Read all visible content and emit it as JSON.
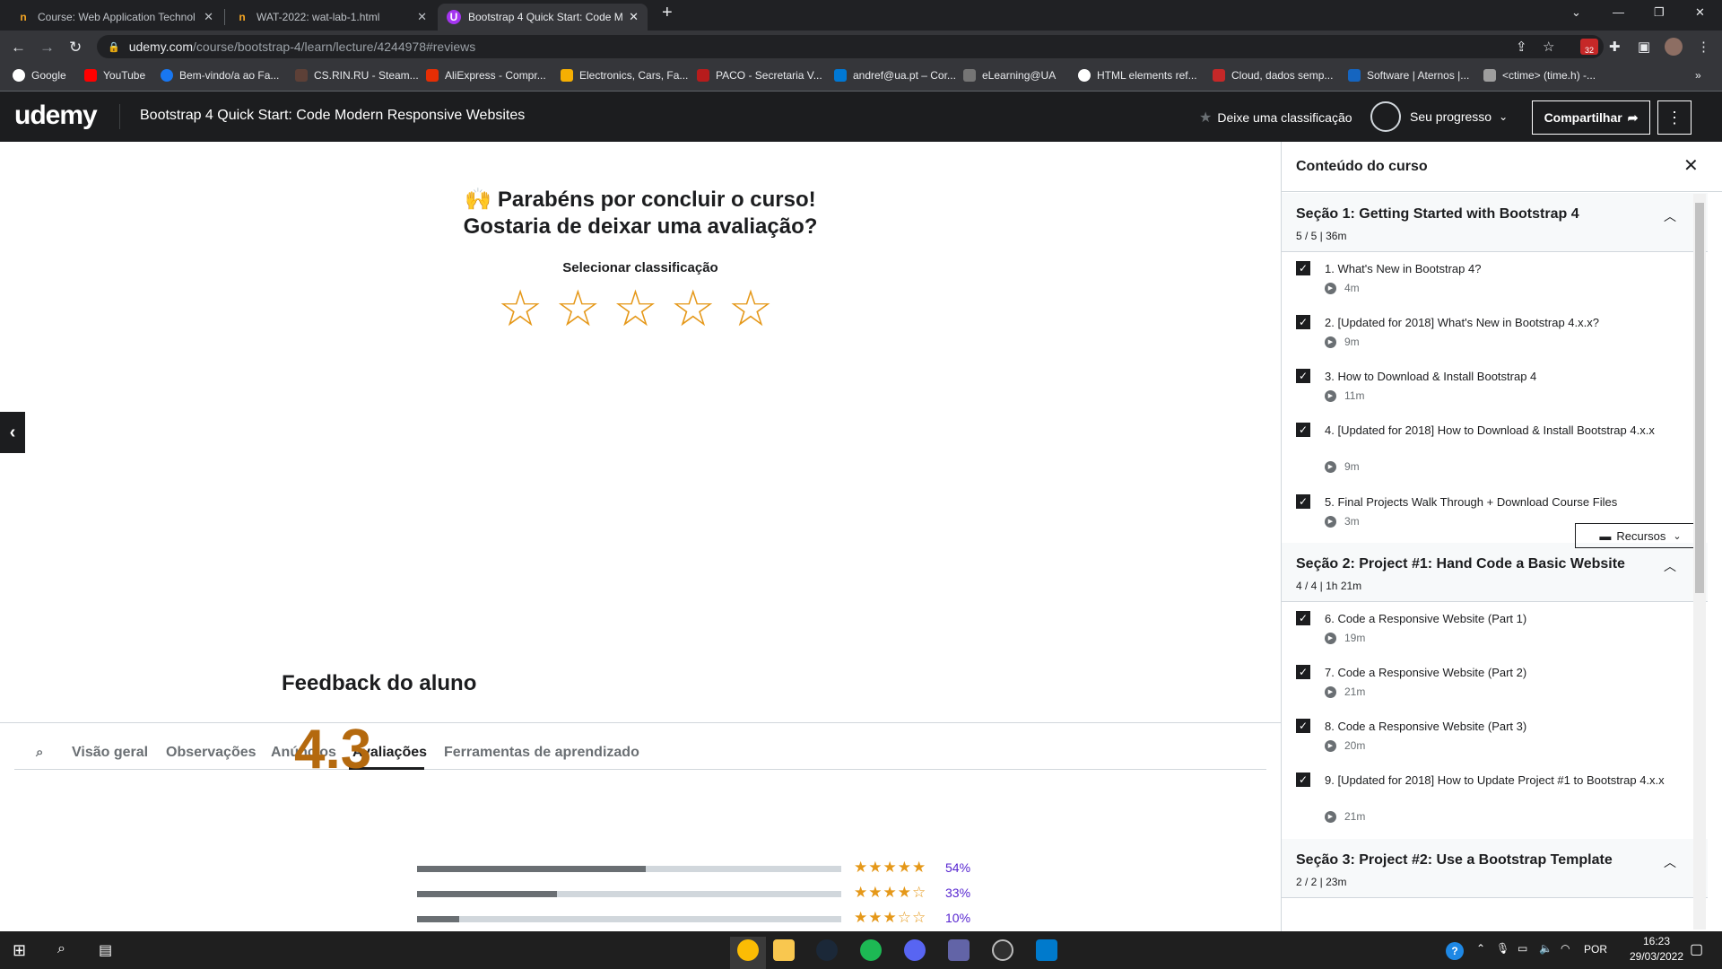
{
  "browser": {
    "tabs": [
      {
        "title": "Course: Web Application Technol",
        "icon": "n"
      },
      {
        "title": "WAT-2022: wat-lab-1.html",
        "icon": "n"
      },
      {
        "title": "Bootstrap 4 Quick Start: Code Mo",
        "icon": "U"
      }
    ],
    "url_host": "udemy.com",
    "url_path": "/course/bootstrap-4/learn/lecture/4244978#reviews",
    "bookmarks": [
      "Google",
      "YouTube",
      "Bem-vindo/a ao Fa...",
      "CS.RIN.RU - Steam...",
      "AliExpress - Compr...",
      "Electronics, Cars, Fa...",
      "PACO - Secretaria V...",
      "andref@ua.pt – Cor...",
      "eLearning@UA",
      "HTML elements ref...",
      "Cloud, dados semp...",
      "Software | Aternos |...",
      "<ctime> (time.h) -..."
    ],
    "ext_badge": "32"
  },
  "header": {
    "logo": "udemy",
    "course_title": "Bootstrap 4 Quick Start: Code Modern Responsive Websites",
    "rate_label": "Deixe uma classificação",
    "progress_label": "Seu progresso",
    "share_label": "Compartilhar"
  },
  "main": {
    "congrats_line1": "🙌 Parabéns por concluir o curso!",
    "congrats_line2": "Gostaria de deixar uma avaliação?",
    "select_rating": "Selecionar classificação",
    "stars_count": 5,
    "tabs": [
      "Visão geral",
      "Observações",
      "Anúncios",
      "Avaliações",
      "Ferramentas de aprendizado"
    ],
    "active_tab": "Avaliações",
    "feedback_title": "Feedback do aluno",
    "average_rating": "4.3",
    "rating_rows": [
      {
        "stars": 5,
        "fraction": 0.54,
        "pct": "54%"
      },
      {
        "stars": 4,
        "fraction": 0.33,
        "pct": "33%"
      },
      {
        "stars": 3,
        "fraction": 0.1,
        "pct": "10%"
      }
    ]
  },
  "sidebar": {
    "title": "Conteúdo do curso",
    "sections": [
      {
        "title": "Seção 1: Getting Started with Bootstrap 4",
        "meta": "5 / 5 | 36m",
        "lectures": [
          {
            "title": "1. What's New in Bootstrap 4?",
            "duration": "4m"
          },
          {
            "title": "2. [Updated for 2018] What's New in Bootstrap 4.x.x?",
            "duration": "9m"
          },
          {
            "title": "3. How to Download & Install Bootstrap 4",
            "duration": "11m"
          },
          {
            "title": "4. [Updated for 2018] How to Download & Install Bootstrap 4.x.x",
            "duration": "9m"
          },
          {
            "title": "5. Final Projects Walk Through + Download Course Files",
            "duration": "3m"
          }
        ]
      },
      {
        "title": "Seção 2: Project #1: Hand Code a Basic Website",
        "meta": "4 / 4 | 1h 21m",
        "lectures": [
          {
            "title": "6. Code a Responsive Website (Part 1)",
            "duration": "19m"
          },
          {
            "title": "7. Code a Responsive Website (Part 2)",
            "duration": "21m"
          },
          {
            "title": "8. Code a Responsive Website (Part 3)",
            "duration": "20m"
          },
          {
            "title": "9. [Updated for 2018] How to Update Project #1 to Bootstrap 4.x.x",
            "duration": "21m"
          }
        ]
      },
      {
        "title": "Seção 3: Project #2: Use a Bootstrap Template",
        "meta": "2 / 2 | 23m",
        "lectures": []
      }
    ],
    "resources_label": "Recursos"
  },
  "taskbar": {
    "lang": "POR",
    "time": "16:23",
    "date": "29/03/2022"
  },
  "colors": {
    "accent_purple": "#a435f0",
    "star_gold": "#e59819",
    "rating_brown": "#b4690e",
    "dark": "#1c1d1f"
  }
}
